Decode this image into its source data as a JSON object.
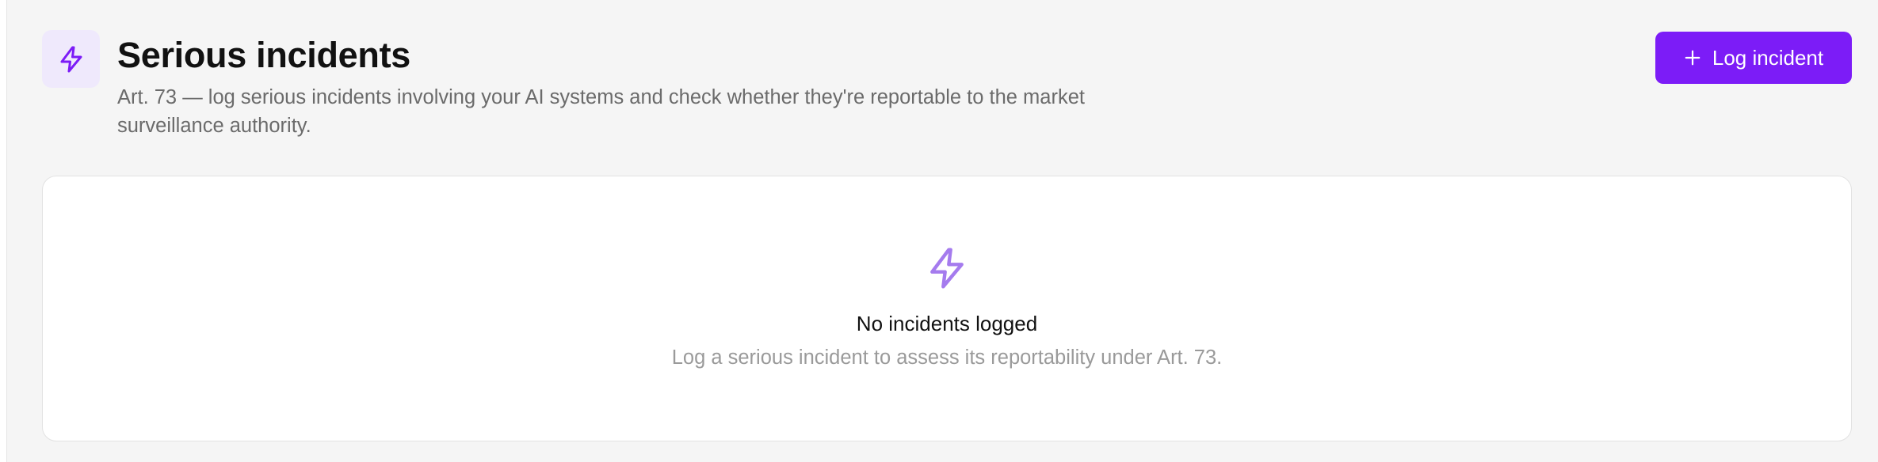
{
  "header": {
    "icon": "lightning-bolt-icon",
    "title": "Serious incidents",
    "subtitle": "Art. 73 — log serious incidents involving your AI systems and check whether they're reportable to the market surveillance authority."
  },
  "actions": {
    "log_incident_label": "Log incident",
    "log_incident_icon": "plus-icon"
  },
  "empty_state": {
    "icon": "lightning-bolt-icon",
    "title": "No incidents logged",
    "description": "Log a serious incident to assess its reportability under Art. 73."
  },
  "colors": {
    "accent": "#7c1cf7",
    "accent_soft": "#efe9fc",
    "empty_icon": "#a57bee",
    "background": "#f5f5f5"
  }
}
